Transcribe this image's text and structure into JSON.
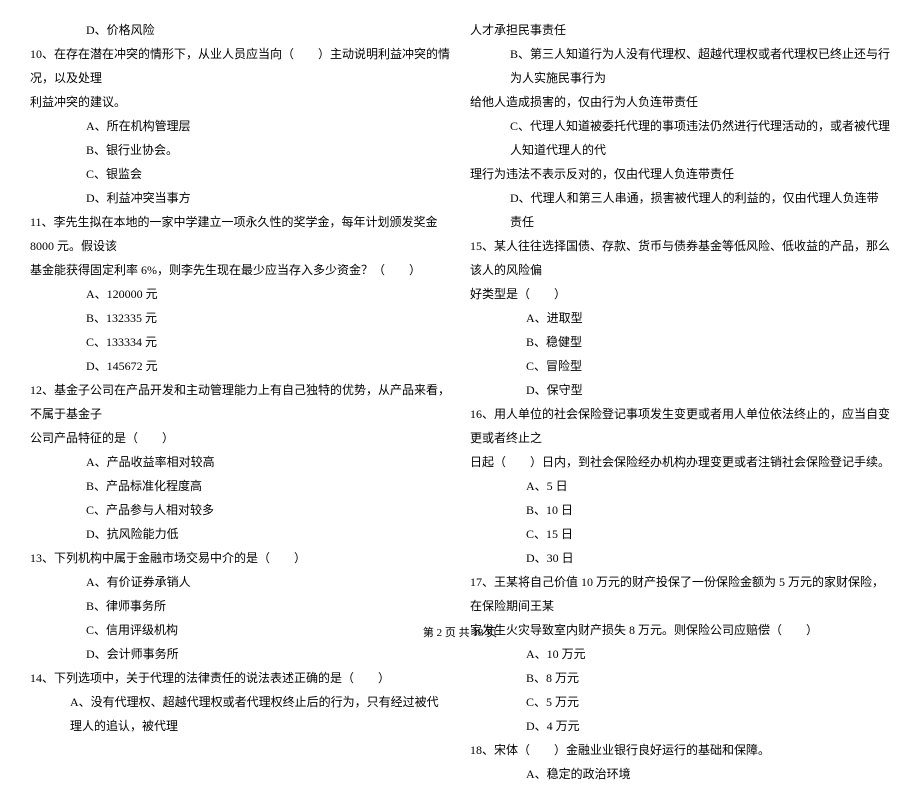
{
  "left": {
    "q9d": "D、价格风险",
    "q10_1": "10、在存在潜在冲突的情形下，从业人员应当向（　　）主动说明利益冲突的情况，以及处理",
    "q10_2": "利益冲突的建议。",
    "q10a": "A、所在机构管理层",
    "q10b": "B、银行业协会。",
    "q10c": "C、银监会",
    "q10d": "D、利益冲突当事方",
    "q11_1": "11、李先生拟在本地的一家中学建立一项永久性的奖学金，每年计划颁发奖金 8000 元。假设该",
    "q11_2": "基金能获得固定利率 6%，则李先生现在最少应当存入多少资金？（　　）",
    "q11a": "A、120000 元",
    "q11b": "B、132335 元",
    "q11c": "C、133334 元",
    "q11d": "D、145672 元",
    "q12_1": "12、基金子公司在产品开发和主动管理能力上有自己独特的优势，从产品来看，不属于基金子",
    "q12_2": "公司产品特征的是（　　）",
    "q12a": "A、产品收益率相对较高",
    "q12b": "B、产品标准化程度高",
    "q12c": "C、产品参与人相对较多",
    "q12d": "D、抗风险能力低",
    "q13_1": "13、下列机构中属于金融市场交易中介的是（　　）",
    "q13a": "A、有价证券承销人",
    "q13b": "B、律师事务所",
    "q13c": "C、信用评级机构",
    "q13d": "D、会计师事务所",
    "q14_1": "14、下列选项中，关于代理的法律责任的说法表述正确的是（　　）",
    "q14_2": "A、没有代理权、超越代理权或者代理权终止后的行为，只有经过被代理人的追认，被代理"
  },
  "right": {
    "q14_3": "人才承担民事责任",
    "q14b_1": "B、第三人知道行为人没有代理权、超越代理权或者代理权已终止还与行为人实施民事行为",
    "q14b_2": "给他人造成损害的，仅由行为人负连带责任",
    "q14c_1": "C、代理人知道被委托代理的事项违法仍然进行代理活动的，或者被代理人知道代理人的代",
    "q14c_2": "理行为违法不表示反对的，仅由代理人负连带责任",
    "q14d": "D、代理人和第三人串通，损害被代理人的利益的，仅由代理人负连带责任",
    "q15_1": "15、某人往往选择国债、存款、货币与债券基金等低风险、低收益的产品，那么该人的风险偏",
    "q15_2": "好类型是（　　）",
    "q15a": "A、进取型",
    "q15b": "B、稳健型",
    "q15c": "C、冒险型",
    "q15d": "D、保守型",
    "q16_1": "16、用人单位的社会保险登记事项发生变更或者用人单位依法终止的，应当自变更或者终止之",
    "q16_2": "日起（　　）日内，到社会保险经办机构办理变更或者注销社会保险登记手续。",
    "q16a": "A、5 日",
    "q16b": "B、10 日",
    "q16c": "C、15 日",
    "q16d": "D、30 日",
    "q17_1": "17、王某将自己价值 10 万元的财产投保了一份保险金额为 5 万元的家财保险，在保险期间王某",
    "q17_2": "家发生火灾导致室内财产损失 8 万元。则保险公司应赔偿（　　）",
    "q17a": "A、10 万元",
    "q17b": "B、8 万元",
    "q17c": "C、5 万元",
    "q17d": "D、4 万元",
    "q18_1": "18、宋体（　　）金融业业银行良好运行的基础和保障。",
    "q18a": "A、稳定的政治环境"
  },
  "footer": "第 2 页 共 18 页"
}
